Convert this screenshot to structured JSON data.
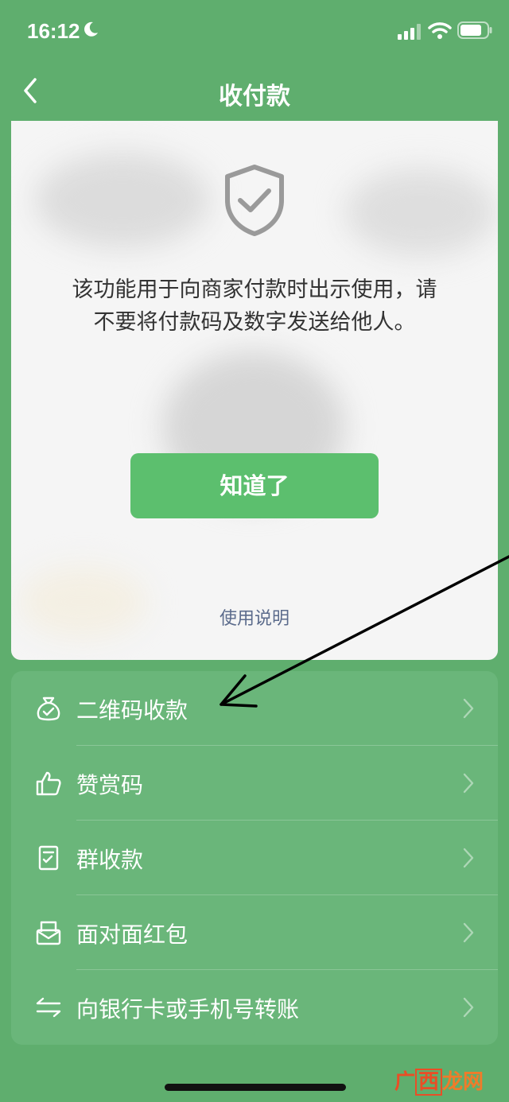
{
  "status_bar": {
    "time": "16:12"
  },
  "nav": {
    "title": "收付款"
  },
  "card": {
    "notice_line1": "该功能用于向商家付款时出示使用，请",
    "notice_line2": "不要将付款码及数字发送给他人。",
    "ok_button": "知道了",
    "usage_link": "使用说明"
  },
  "menu": {
    "items": [
      {
        "label": "二维码收款",
        "icon": "money-bag-icon"
      },
      {
        "label": "赞赏码",
        "icon": "thumbs-up-icon"
      },
      {
        "label": "群收款",
        "icon": "group-bill-icon"
      },
      {
        "label": "面对面红包",
        "icon": "red-packet-icon"
      },
      {
        "label": "向银行卡或手机号转账",
        "icon": "transfer-icon"
      }
    ]
  },
  "watermark": {
    "part1": "广",
    "part2": "西",
    "part3": "龙网"
  },
  "colors": {
    "background": "#5fae6e",
    "button": "#5cbf6e",
    "link": "#5b6b8c"
  }
}
